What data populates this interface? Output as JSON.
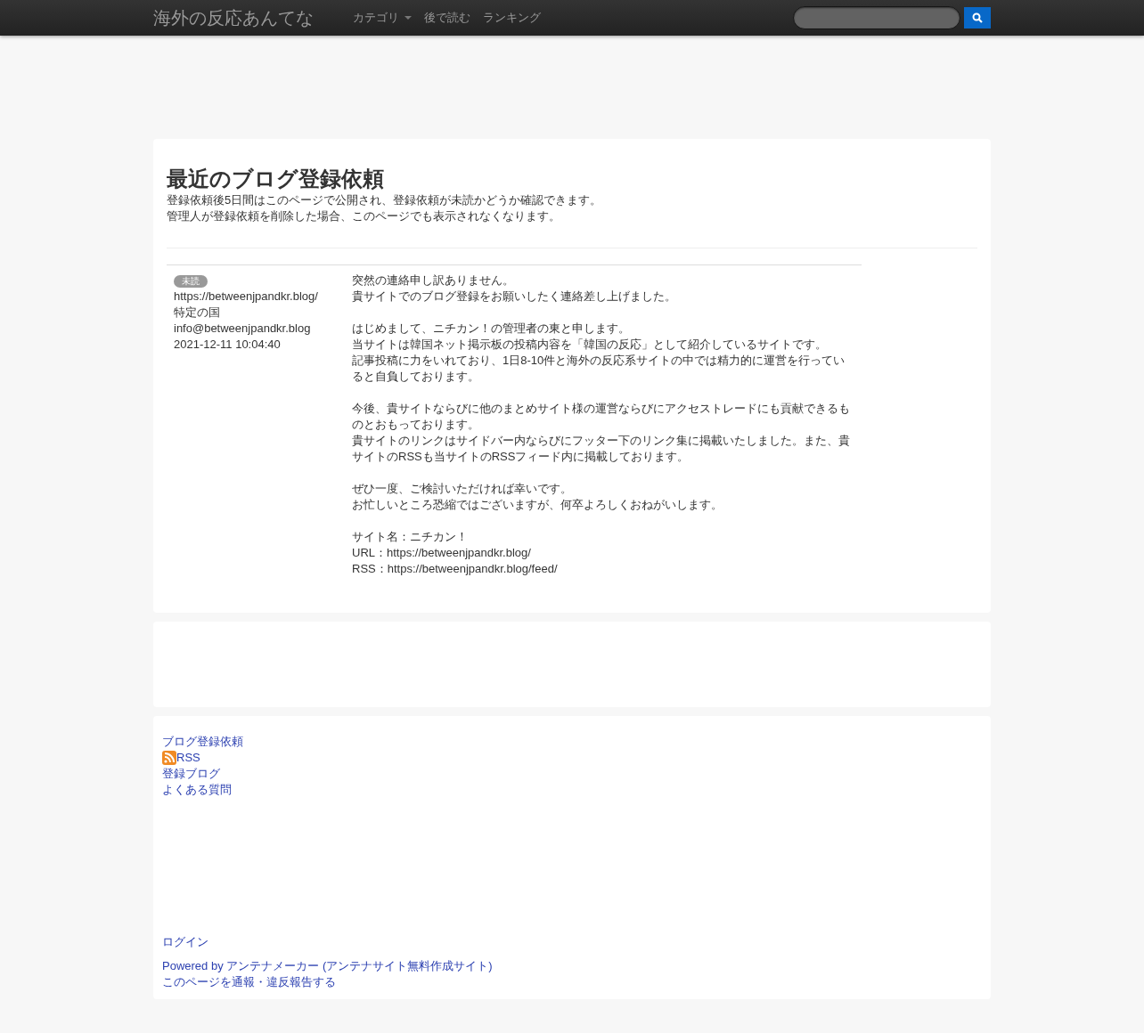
{
  "navbar": {
    "brand": "海外の反応あんてな",
    "menu": [
      {
        "label": "カテゴリ",
        "kind": "dropdown"
      },
      {
        "label": "後で読む",
        "kind": "link"
      },
      {
        "label": "ランキング",
        "kind": "link"
      }
    ]
  },
  "page": {
    "title": "最近のブログ登録依頼",
    "description": [
      "登録依頼後5日間はこのページで公開され、登録依頼が未読かどうか確認できます。",
      "管理人が登録依頼を削除した場合、このページでも表示されなくなります。"
    ]
  },
  "requests": [
    {
      "status": "未読",
      "url": "https://betweenjpandkr.blog/",
      "category": "特定の国",
      "email": "info@betweenjpandkr.blog",
      "date": "2021-12-11 10:04:40",
      "message": [
        [
          "突然の連絡申し訳ありません。",
          "貴サイトでのブログ登録をお願いしたく連絡差し上げました。"
        ],
        [
          "はじめまして、ニチカン！の管理者の東と申します。",
          "当サイトは韓国ネット掲示板の投稿内容を「韓国の反応」として紹介しているサイトです。",
          "記事投稿に力をいれており、1日8-10件と海外の反応系サイトの中では精力的に運営を行っていると自負しております。"
        ],
        [
          "今後、貴サイトならびに他のまとめサイト様の運営ならびにアクセストレードにも貢献できるものとおもっております。",
          "貴サイトのリンクはサイドバー内ならびにフッター下のリンク集に掲載いたしました。また、貴サイトのRSSも当サイトのRSSフィード内に掲載しております。"
        ],
        [
          "ぜひ一度、ご検討いただければ幸いです。",
          "お忙しいところ恐縮ではございますが、何卒よろしくおねがいします。"
        ],
        [
          "サイト名：ニチカン！",
          "URL：https://betweenjpandkr.blog/",
          "RSS：https://betweenjpandkr.blog/feed/"
        ]
      ]
    }
  ],
  "footer": {
    "links": [
      {
        "label": "ブログ登録依頼",
        "kind": "link"
      },
      {
        "label": "RSS",
        "kind": "rss"
      },
      {
        "label": "登録ブログ",
        "kind": "link"
      },
      {
        "label": "よくある質問",
        "kind": "link"
      }
    ],
    "login": "ログイン",
    "powered": {
      "prefix": "Powered by ",
      "link": "アンテナメーカー (アンテナサイト無料作成サイト)"
    },
    "report": "このページを通報・違反報告する"
  }
}
